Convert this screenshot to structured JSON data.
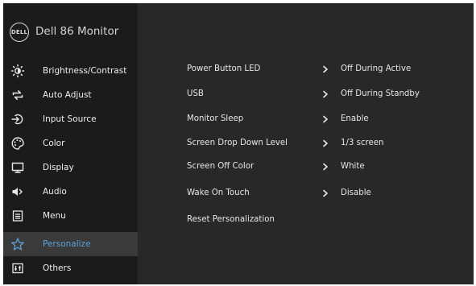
{
  "header": {
    "logo_text": "DELL",
    "model_name": "Dell 86 Monitor"
  },
  "sidebar": {
    "items": [
      {
        "label": "Brightness/Contrast",
        "icon": "brightness-icon"
      },
      {
        "label": "Auto Adjust",
        "icon": "auto-adjust-icon"
      },
      {
        "label": "Input Source",
        "icon": "input-source-icon"
      },
      {
        "label": "Color",
        "icon": "color-palette-icon"
      },
      {
        "label": "Display",
        "icon": "display-icon"
      },
      {
        "label": "Audio",
        "icon": "speaker-icon"
      },
      {
        "label": "Menu",
        "icon": "menu-icon"
      },
      {
        "label": "Personalize",
        "icon": "star-icon",
        "selected": true
      },
      {
        "label": "Others",
        "icon": "others-icon"
      }
    ]
  },
  "personalize": {
    "rows": [
      {
        "label": "Power Button LED",
        "value": "Off During Active"
      },
      {
        "label": "USB",
        "value": "Off During Standby"
      },
      {
        "label": "Monitor Sleep",
        "value": "Enable"
      },
      {
        "label": "Screen Drop Down Level",
        "value": "1/3 screen"
      },
      {
        "label": "Screen Off Color",
        "value": "White"
      },
      {
        "label": "Wake On Touch",
        "value": "Disable"
      },
      {
        "label": "Reset Personalization"
      }
    ]
  },
  "colors": {
    "panel_background": "#282828",
    "sidebar_background": "#1b1b1b",
    "selected_background": "#3a3a3a",
    "accent": "#5fa2d9",
    "text": "#e6e6e6"
  }
}
